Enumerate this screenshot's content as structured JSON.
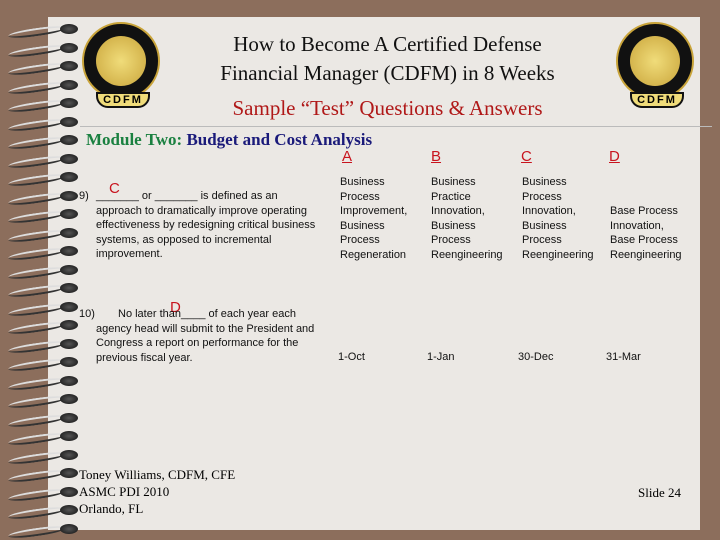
{
  "title": "How to Become A Certified Defense Financial Manager (CDFM) in 8 Weeks",
  "title_line1": "How to Become A Certified Defense",
  "title_line2": "Financial Manager (CDFM) in 8 Weeks",
  "subtitle": "Sample “Test” Questions & Answers",
  "logo_text": "CDFM",
  "module_label": "Module Two:",
  "module_name": "Budget and Cost Analysis",
  "columns": [
    "A",
    "B",
    "C",
    "D"
  ],
  "questions": [
    {
      "number": "9)",
      "answer": "C",
      "text": "_______ or _______ is defined as an\napproach to dramatically improve operating\neffectiveness by redesigning critical business\nsystems, as opposed to incremental\nimprovement.",
      "options": [
        "Business\nProcess\nImprovement,\nBusiness\nProcess\nRegeneration",
        "Business\nPractice\nInnovation,\nBusiness\nProcess\nReengineering",
        "Business\nProcess\nInnovation,\nBusiness\nProcess\nReengineering",
        "\n\nBase Process\nInnovation,\nBase Process\nReengineering"
      ]
    },
    {
      "number": "10)",
      "answer": "D",
      "text": "No later than____ of each year each\nagency head will submit to the President and\nCongress a report on performance for the\nprevious fiscal year.",
      "options": [
        "1-Oct",
        "1-Jan",
        "30-Dec",
        "31-Mar"
      ]
    }
  ],
  "footer": "Toney Williams, CDFM, CFE\nASMC PDI 2010\nOrlando, FL",
  "slide_number": "Slide 24",
  "colors": {
    "title": "#111111",
    "subtitle": "#b01818",
    "module_label": "#1a8040",
    "module_name": "#1a1a7a",
    "answer": "#c8141e"
  }
}
